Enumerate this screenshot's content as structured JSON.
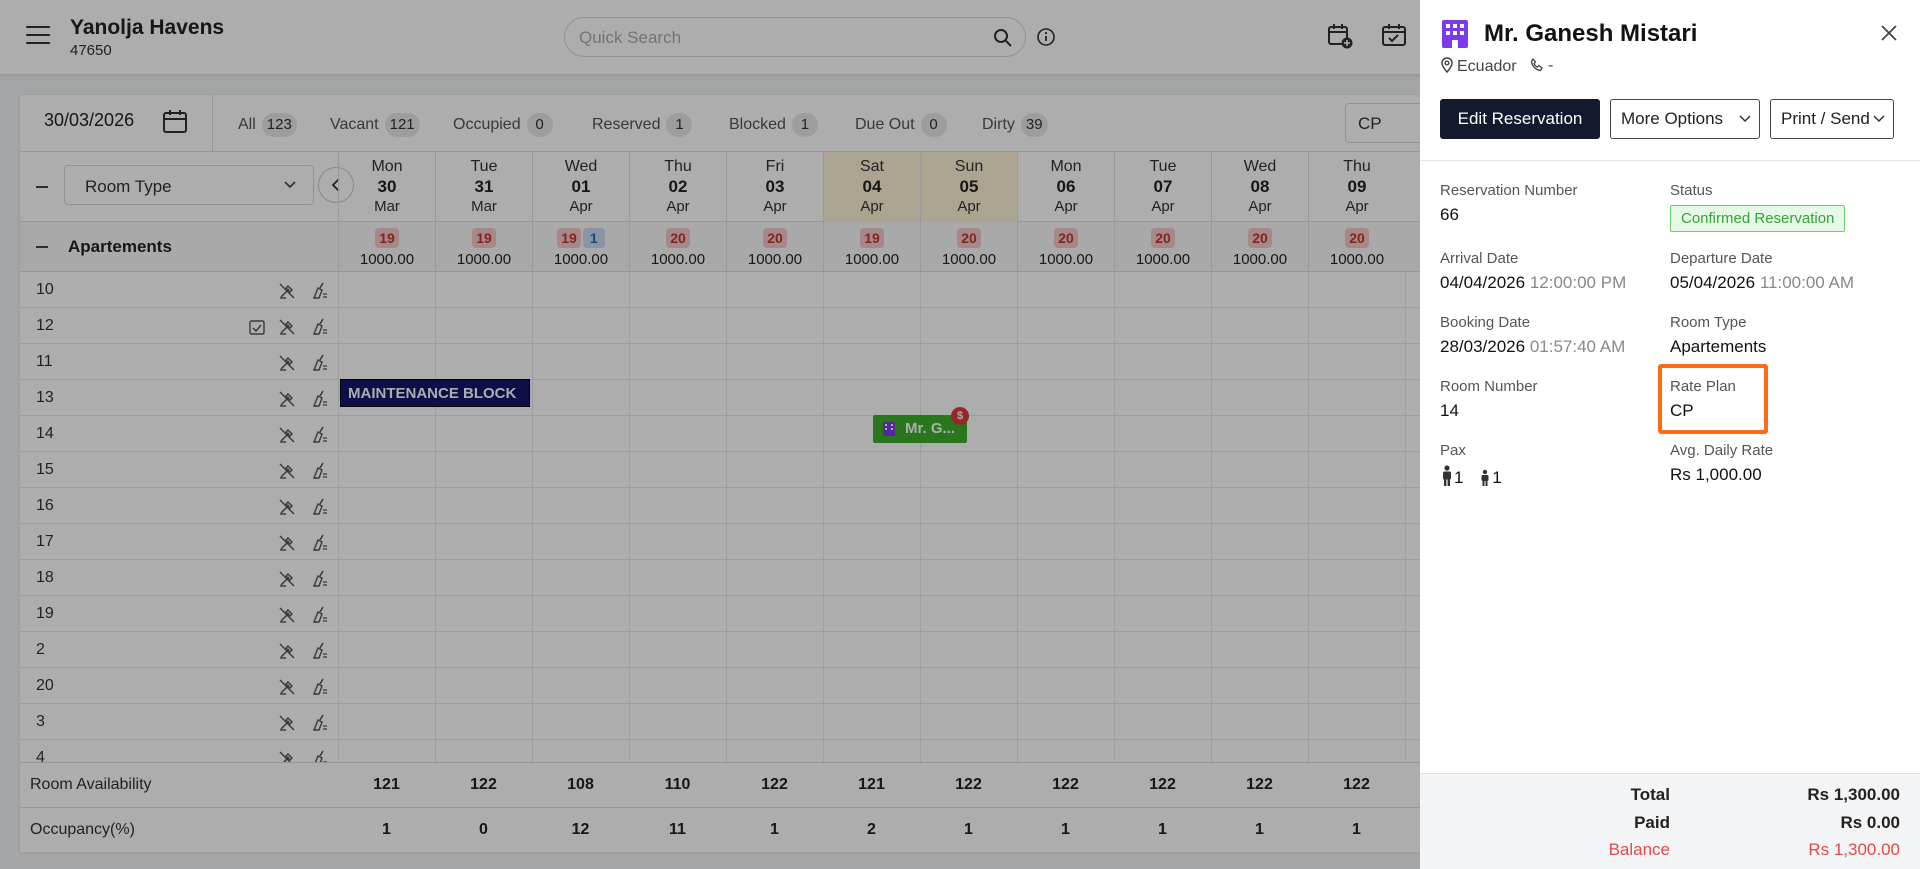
{
  "header": {
    "hotel_name": "Yanolja Havens",
    "hotel_id": "47650",
    "search_placeholder": "Quick Search"
  },
  "filters": {
    "date": "30/03/2026",
    "items": [
      {
        "label": "All",
        "count": "123"
      },
      {
        "label": "Vacant",
        "count": "121"
      },
      {
        "label": "Occupied",
        "count": "0"
      },
      {
        "label": "Reserved",
        "count": "1"
      },
      {
        "label": "Blocked",
        "count": "1"
      },
      {
        "label": "Due Out",
        "count": "0"
      },
      {
        "label": "Dirty",
        "count": "39"
      }
    ],
    "rate_plan": "CP"
  },
  "grid": {
    "room_type_select": "Room Type",
    "days": [
      {
        "dow": "Mon",
        "day": "30",
        "month": "Mar"
      },
      {
        "dow": "Tue",
        "day": "31",
        "month": "Mar"
      },
      {
        "dow": "Wed",
        "day": "01",
        "month": "Apr"
      },
      {
        "dow": "Thu",
        "day": "02",
        "month": "Apr"
      },
      {
        "dow": "Fri",
        "day": "03",
        "month": "Apr"
      },
      {
        "dow": "Sat",
        "day": "04",
        "month": "Apr"
      },
      {
        "dow": "Sun",
        "day": "05",
        "month": "Apr"
      },
      {
        "dow": "Mon",
        "day": "06",
        "month": "Apr"
      },
      {
        "dow": "Tue",
        "day": "07",
        "month": "Apr"
      },
      {
        "dow": "Wed",
        "day": "08",
        "month": "Apr"
      },
      {
        "dow": "Thu",
        "day": "09",
        "month": "Apr"
      }
    ],
    "group": {
      "name": "Apartements",
      "cells": [
        {
          "avail": "19",
          "extra": "",
          "rate": "1000.00"
        },
        {
          "avail": "19",
          "extra": "",
          "rate": "1000.00"
        },
        {
          "avail": "19",
          "extra": "1",
          "rate": "1000.00"
        },
        {
          "avail": "20",
          "extra": "",
          "rate": "1000.00"
        },
        {
          "avail": "20",
          "extra": "",
          "rate": "1000.00"
        },
        {
          "avail": "19",
          "extra": "",
          "rate": "1000.00"
        },
        {
          "avail": "20",
          "extra": "",
          "rate": "1000.00"
        },
        {
          "avail": "20",
          "extra": "",
          "rate": "1000.00"
        },
        {
          "avail": "20",
          "extra": "",
          "rate": "1000.00"
        },
        {
          "avail": "20",
          "extra": "",
          "rate": "1000.00"
        },
        {
          "avail": "20",
          "extra": "",
          "rate": "1000.00"
        }
      ]
    },
    "rooms": [
      "10",
      "12",
      "11",
      "13",
      "14",
      "15",
      "16",
      "17",
      "18",
      "19",
      "2",
      "20",
      "3",
      "4"
    ],
    "maintenance_label": "MAINTENANCE BLOCK",
    "reservation_chip": "Mr. G...",
    "reservation_chip_badge": "$",
    "availability_label": "Room Availability",
    "availability": [
      "121",
      "122",
      "108",
      "110",
      "122",
      "121",
      "122",
      "122",
      "122",
      "122",
      "122"
    ],
    "occupancy_label": "Occupancy(%)",
    "occupancy": [
      "1",
      "0",
      "12",
      "11",
      "1",
      "2",
      "1",
      "1",
      "1",
      "1",
      "1"
    ]
  },
  "panel": {
    "guest_name": "Mr. Ganesh Mistari",
    "location": "Ecuador",
    "phone": "-",
    "edit_button": "Edit Reservation",
    "more_options": "More Options",
    "print_send": "Print / Send",
    "fields": {
      "reservation_number_label": "Reservation Number",
      "reservation_number": "66",
      "status_label": "Status",
      "status": "Confirmed Reservation",
      "arrival_label": "Arrival Date",
      "arrival_date": "04/04/2026",
      "arrival_time": "12:00:00 PM",
      "departure_label": "Departure Date",
      "departure_date": "05/04/2026",
      "departure_time": "11:00:00 AM",
      "booking_label": "Booking Date",
      "booking_date": "28/03/2026",
      "booking_time": "01:57:40 AM",
      "room_type_label": "Room Type",
      "room_type": "Apartements",
      "room_number_label": "Room Number",
      "room_number": "14",
      "rate_plan_label": "Rate Plan",
      "rate_plan": "CP",
      "pax_label": "Pax",
      "adults": "1",
      "children": "1",
      "avg_rate_label": "Avg. Daily Rate",
      "avg_rate": "Rs 1,000.00"
    },
    "totals": {
      "total_label": "Total",
      "total": "Rs 1,300.00",
      "paid_label": "Paid",
      "paid": "Rs 0.00",
      "balance_label": "Balance",
      "balance": "Rs 1,300.00"
    }
  },
  "colors": {
    "weekend": "#fdf2d4",
    "maintenance": "#15156a",
    "reservation": "#3dae2b",
    "highlight": "#ff6a13",
    "status_green": "#37a337",
    "balance_red": "#e84848"
  }
}
